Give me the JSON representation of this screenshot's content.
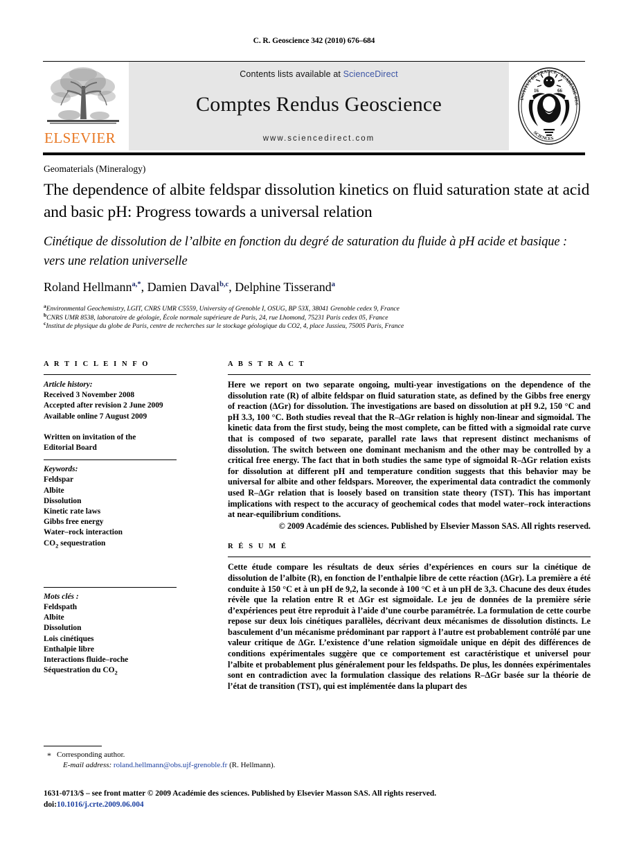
{
  "running_head": "C. R. Geoscience 342 (2010) 676–684",
  "masthead": {
    "contents_prefix": "Contents lists available at ",
    "sciencedirect": "ScienceDirect",
    "journal_title": "Comptes Rendus Geoscience",
    "url": "www.sciencedirect.com",
    "elsevier_wordmark": "ELSEVIER",
    "elsevier_color": "#E87722",
    "link_color": "#3a53a4",
    "band_color": "#e6e6e6"
  },
  "article": {
    "section_label": "Geomaterials (Mineralogy)",
    "title_en": "The dependence of albite feldspar dissolution kinetics on fluid saturation state at acid and basic pH: Progress towards a universal relation",
    "title_fr": "Cinétique de dissolution de l’albite en fonction du degré de saturation du fluide à pH acide et basique : vers une relation universelle",
    "authors": [
      {
        "name": "Roland Hellmann",
        "marks": "a,*"
      },
      {
        "name": "Damien Daval",
        "marks": "b,c"
      },
      {
        "name": "Delphine Tisserand",
        "marks": "a"
      }
    ],
    "affiliations": [
      {
        "mark": "a",
        "text": "Environmental Geochemistry, LGIT, CNRS UMR C5559, University of Grenoble I, OSUG, BP 53X, 38041 Grenoble cedex 9, France"
      },
      {
        "mark": "b",
        "text": "CNRS UMR 8538, laboratoire de géologie, École normale supérieure de Paris, 24, rue Lhomond, 75231 Paris cedex 05, France"
      },
      {
        "mark": "c",
        "text": "Institut de physique du globe de Paris, centre de recherches sur le stockage géologique du CO2, 4, place Jussieu, 75005 Paris, France"
      }
    ]
  },
  "article_info": {
    "heading": "A R T I C L E  I N F O",
    "history_label": "Article history:",
    "history": [
      "Received 3 November 2008",
      "Accepted after revision 2 June 2009",
      "Available online 7 August 2009"
    ],
    "invitation": [
      "Written on invitation of the",
      "Editorial Board"
    ],
    "keywords_label": "Keywords:",
    "keywords": [
      "Feldspar",
      "Albite",
      "Dissolution",
      "Kinetic rate laws",
      "Gibbs free energy",
      "Water–rock interaction",
      "CO2 sequestration"
    ],
    "motscles_label": "Mots clés :",
    "motscles": [
      "Feldspath",
      "Albite",
      "Dissolution",
      "Lois cinétiques",
      "Enthalpie libre",
      "Interactions fluide–roche",
      "Séquestration du CO2"
    ]
  },
  "abstract": {
    "heading": "A B S T R A C T",
    "text": "Here we report on two separate ongoing, multi-year investigations on the dependence of the dissolution rate (R) of albite feldspar on fluid saturation state, as defined by the Gibbs free energy of reaction (ΔGr) for dissolution. The investigations are based on dissolution at pH 9.2, 150 °C and pH 3.3, 100 °C. Both studies reveal that the R–ΔGr relation is highly non-linear and sigmoidal. The kinetic data from the first study, being the most complete, can be fitted with a sigmoidal rate curve that is composed of two separate, parallel rate laws that represent distinct mechanisms of dissolution. The switch between one dominant mechanism and the other may be controlled by a critical free energy. The fact that in both studies the same type of sigmoidal R–ΔGr relation exists for dissolution at different pH and temperature condition suggests that this behavior may be universal for albite and other feldspars. Moreover, the experimental data contradict the commonly used R–ΔGr relation that is loosely based on transition state theory (TST). This has important implications with respect to the accuracy of geochemical codes that model water–rock interactions at near-equilibrium conditions.",
    "copyright": "© 2009 Académie des sciences. Published by Elsevier Masson SAS. All rights reserved."
  },
  "resume": {
    "heading": "R É S U M É",
    "text": "Cette étude compare les résultats de deux séries d’expériences en cours sur la cinétique de dissolution de l’albite (R), en fonction de l’enthalpie libre de cette réaction (ΔGr). La première a été conduite à 150 °C et à un pH de 9,2, la seconde à 100 °C et à un pH de 3,3. Chacune des deux études révèle que la relation entre R et ΔGr est sigmoïdale. Le jeu de données de la première série d’expériences peut être reproduit à l’aide d’une courbe paramétrée. La formulation de cette courbe repose sur deux lois cinétiques parallèles, décrivant deux mécanismes de dissolution distincts. Le basculement d’un mécanisme prédominant par rapport à l’autre est probablement contrôlé par une valeur critique de ΔGr. L’existence d’une relation sigmoïdale unique en dépit des différences de conditions expérimentales suggère que ce comportement est caractéristique et universel pour l’albite et probablement plus généralement pour les feldspaths. De plus, les données expérimentales sont en contradiction avec la formulation classique des relations R–ΔGr basée sur la théorie de l’état de transition (TST), qui est implémentée dans la plupart des"
  },
  "footer": {
    "corresponding_marker": "*",
    "corresponding_author": "Corresponding author.",
    "email_label": "E-mail address:",
    "email": "roland.hellmann@obs.ujf-grenoble.fr",
    "email_suffix": "(R. Hellmann).",
    "imprint": "1631-0713/$ – see front matter © 2009 Académie des sciences. Published by Elsevier Masson SAS. All rights reserved.",
    "doi_label": "doi:",
    "doi": "10.1016/j.crte.2009.06.004"
  }
}
